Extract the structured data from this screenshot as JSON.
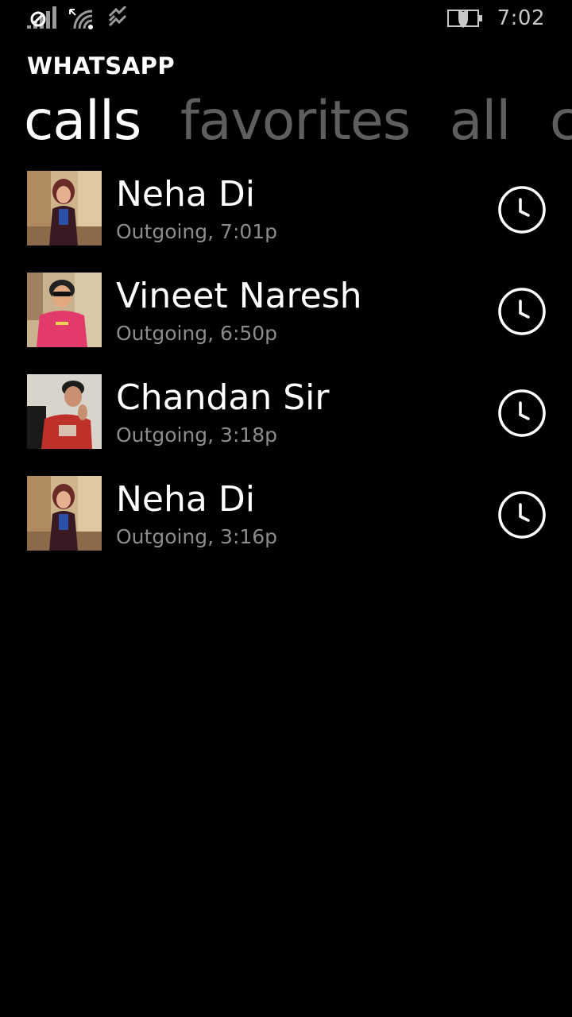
{
  "status_bar": {
    "time": "7:02",
    "icons": [
      "signal-icon",
      "wifi-icon",
      "data-sync-icon",
      "battery-saver-icon"
    ]
  },
  "app": {
    "title": "WHATSAPP"
  },
  "pivot": {
    "tabs": [
      {
        "label": "calls",
        "active": true
      },
      {
        "label": "favorites",
        "active": false
      },
      {
        "label": "all",
        "active": false
      },
      {
        "label": "chats",
        "active": false
      }
    ]
  },
  "calls": [
    {
      "name": "Neha Di",
      "detail": "Outgoing, 7:01p",
      "action_icon": "clock-icon"
    },
    {
      "name": "Vineet Naresh",
      "detail": "Outgoing, 6:50p",
      "action_icon": "clock-icon"
    },
    {
      "name": "Chandan Sir",
      "detail": "Outgoing, 3:18p",
      "action_icon": "clock-icon"
    },
    {
      "name": "Neha Di",
      "detail": "Outgoing, 3:16p",
      "action_icon": "clock-icon"
    }
  ],
  "colors": {
    "background": "#000000",
    "text_primary": "#ffffff",
    "text_secondary": "#8c8c8c",
    "tab_inactive": "#5e5e5e"
  }
}
